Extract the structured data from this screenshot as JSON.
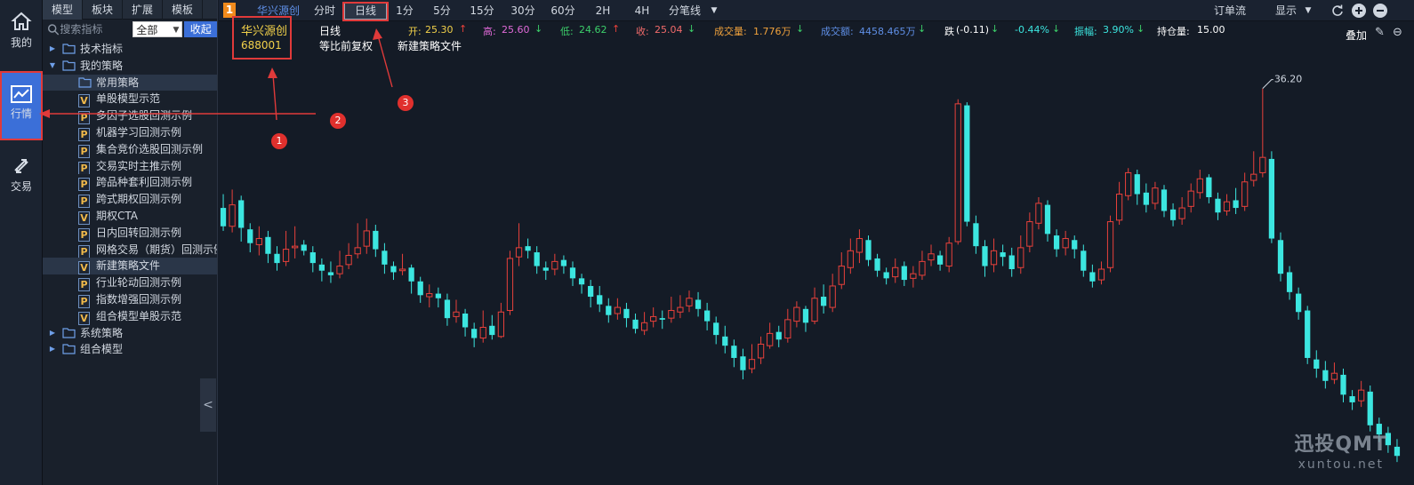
{
  "leftnav": {
    "items": [
      {
        "label": "我的",
        "icon": "home-icon"
      },
      {
        "label": "行情",
        "icon": "chart-icon"
      },
      {
        "label": "交易",
        "icon": "transfer-icon"
      }
    ]
  },
  "panel": {
    "tabs": [
      "模型",
      "板块",
      "扩展",
      "模板"
    ],
    "search_placeholder": "搜索指标",
    "filter_value": "全部",
    "collapse_label": "收起",
    "tree": [
      {
        "label": "技术指标",
        "level": 0,
        "kind": "folder",
        "expanded": false
      },
      {
        "label": "我的策略",
        "level": 0,
        "kind": "folder",
        "expanded": true
      },
      {
        "label": "常用策略",
        "level": 1,
        "kind": "folder",
        "selected": true
      },
      {
        "label": "单股模型示范",
        "level": 1,
        "kind": "V"
      },
      {
        "label": "多因子选股回测示例",
        "level": 1,
        "kind": "P"
      },
      {
        "label": "机器学习回测示例",
        "level": 1,
        "kind": "P"
      },
      {
        "label": "集合竞价选股回测示例",
        "level": 1,
        "kind": "P"
      },
      {
        "label": "交易实时主推示例",
        "level": 1,
        "kind": "P"
      },
      {
        "label": "跨品种套利回测示例",
        "level": 1,
        "kind": "P"
      },
      {
        "label": "跨式期权回测示例",
        "level": 1,
        "kind": "P"
      },
      {
        "label": "期权CTA",
        "level": 1,
        "kind": "V"
      },
      {
        "label": "日内回转回测示例",
        "level": 1,
        "kind": "P"
      },
      {
        "label": "网格交易（期货）回测示例",
        "level": 1,
        "kind": "P"
      },
      {
        "label": "新建策略文件",
        "level": 1,
        "kind": "V",
        "selected": true
      },
      {
        "label": "行业轮动回测示例",
        "level": 1,
        "kind": "P"
      },
      {
        "label": "指数增强回测示例",
        "level": 1,
        "kind": "P"
      },
      {
        "label": "组合模型单股示范",
        "level": 1,
        "kind": "V"
      },
      {
        "label": "系统策略",
        "level": 0,
        "kind": "folder",
        "expanded": false
      },
      {
        "label": "组合模型",
        "level": 0,
        "kind": "folder",
        "expanded": false
      }
    ]
  },
  "toolbar": {
    "tab_number": "1",
    "stock_tab": "华兴源创",
    "periods": [
      "分时",
      "日线",
      "1分",
      "5分",
      "15分",
      "30分",
      "60分",
      "2H",
      "4H",
      "分笔线"
    ],
    "active_period": "日线",
    "order_flow": "订单流",
    "display": "显示"
  },
  "stock": {
    "name": "华兴源创",
    "code": "688001"
  },
  "info": {
    "period": "日线",
    "adjust": "等比前复权",
    "strategy_file": "新建策略文件",
    "open_label": "开:",
    "open": "25.30",
    "high_label": "高:",
    "high": "25.60",
    "low_label": "低:",
    "low": "24.62",
    "close_label": "收:",
    "close": "25.04",
    "volume_label": "成交量:",
    "volume": "1.776万",
    "amount_label": "成交额:",
    "amount": "4458.465万",
    "change_label": "跌",
    "change": "(-0.11)",
    "change_pct": "-0.44%",
    "amplitude_label": "振幅:",
    "amplitude": "3.90%",
    "position_label": "持仓量:",
    "position": "15.00",
    "overlay": "叠加"
  },
  "chart_data": {
    "type": "candlestick",
    "max_label": "36.20",
    "up_color": "#e8413b",
    "down_color": "#3ce6e0",
    "candles": [
      [
        28.4,
        27.2,
        29.3,
        26.9
      ],
      [
        27.2,
        28.6,
        29.6,
        26.8
      ],
      [
        28.9,
        27.1,
        29.2,
        26.2
      ],
      [
        27.0,
        26.1,
        27.4,
        25.5
      ],
      [
        26.0,
        26.4,
        27.2,
        25.3
      ],
      [
        26.5,
        25.4,
        26.9,
        24.8
      ],
      [
        25.4,
        24.8,
        25.9,
        24.3
      ],
      [
        24.9,
        25.7,
        26.9,
        24.6
      ],
      [
        25.8,
        25.9,
        27.2,
        25.1
      ],
      [
        26.0,
        25.6,
        26.3,
        25.3
      ],
      [
        25.5,
        24.8,
        25.9,
        24.2
      ],
      [
        24.7,
        24.3,
        25.1,
        23.6
      ],
      [
        24.2,
        24.0,
        24.9,
        23.5
      ],
      [
        24.1,
        24.6,
        25.6,
        23.8
      ],
      [
        24.7,
        25.3,
        26.1,
        24.4
      ],
      [
        25.4,
        25.8,
        27.4,
        25.1
      ],
      [
        25.9,
        26.9,
        27.7,
        25.4
      ],
      [
        26.9,
        25.7,
        27.3,
        25.2
      ],
      [
        25.6,
        24.7,
        26.1,
        24.1
      ],
      [
        24.6,
        24.2,
        24.9,
        23.7
      ],
      [
        24.3,
        24.4,
        25.4,
        24.0
      ],
      [
        24.5,
        23.6,
        24.7,
        22.8
      ],
      [
        23.6,
        22.7,
        23.9,
        22.2
      ],
      [
        22.6,
        22.8,
        23.4,
        21.9
      ],
      [
        22.8,
        22.5,
        23.2,
        21.9
      ],
      [
        22.4,
        21.2,
        22.8,
        20.7
      ],
      [
        21.3,
        21.6,
        22.4,
        20.9
      ],
      [
        21.5,
        20.6,
        21.8,
        20.0
      ],
      [
        20.5,
        19.9,
        20.9,
        19.3
      ],
      [
        19.9,
        20.6,
        21.7,
        19.6
      ],
      [
        20.7,
        20.1,
        21.4,
        19.8
      ],
      [
        20.0,
        21.6,
        22.2,
        19.9
      ],
      [
        21.7,
        25.1,
        25.6,
        21.4
      ],
      [
        25.2,
        25.8,
        27.4,
        24.6
      ],
      [
        25.9,
        25.6,
        26.4,
        25.1
      ],
      [
        25.5,
        24.6,
        25.9,
        24.1
      ],
      [
        24.5,
        24.3,
        24.9,
        23.7
      ],
      [
        24.4,
        24.9,
        25.4,
        24.0
      ],
      [
        25.0,
        24.6,
        25.3,
        24.1
      ],
      [
        24.5,
        23.8,
        24.9,
        23.3
      ],
      [
        23.8,
        23.4,
        24.1,
        22.8
      ],
      [
        23.3,
        22.6,
        23.7,
        21.9
      ],
      [
        22.7,
        22.1,
        23.3,
        21.6
      ],
      [
        22.0,
        21.4,
        22.5,
        20.9
      ],
      [
        21.5,
        21.9,
        22.5,
        21.1
      ],
      [
        21.8,
        21.2,
        22.2,
        20.6
      ],
      [
        21.1,
        20.5,
        21.5,
        20.2
      ],
      [
        20.4,
        20.9,
        21.6,
        20.1
      ],
      [
        21.0,
        21.3,
        21.9,
        20.6
      ],
      [
        21.2,
        21.1,
        21.7,
        20.5
      ],
      [
        21.2,
        21.7,
        22.6,
        20.9
      ],
      [
        21.6,
        21.9,
        22.7,
        21.2
      ],
      [
        22.0,
        22.5,
        23.0,
        21.6
      ],
      [
        22.4,
        21.8,
        22.9,
        21.3
      ],
      [
        21.7,
        21.0,
        22.2,
        20.4
      ],
      [
        20.9,
        20.1,
        21.3,
        19.5
      ],
      [
        20.0,
        19.4,
        20.7,
        18.9
      ],
      [
        19.4,
        18.6,
        19.8,
        18.0
      ],
      [
        18.7,
        17.8,
        19.2,
        17.2
      ],
      [
        17.9,
        18.5,
        19.5,
        17.6
      ],
      [
        18.6,
        19.5,
        20.0,
        18.2
      ],
      [
        19.4,
        20.2,
        20.9,
        19.2
      ],
      [
        20.3,
        19.8,
        20.7,
        19.3
      ],
      [
        19.9,
        21.1,
        21.8,
        19.6
      ],
      [
        21.0,
        21.9,
        22.3,
        20.6
      ],
      [
        21.8,
        20.9,
        22.0,
        20.3
      ],
      [
        21.0,
        22.5,
        23.2,
        20.8
      ],
      [
        22.6,
        22.0,
        23.4,
        21.5
      ],
      [
        21.9,
        23.3,
        24.1,
        21.6
      ],
      [
        23.4,
        24.6,
        25.5,
        23.1
      ],
      [
        24.5,
        25.6,
        26.4,
        24.1
      ],
      [
        25.5,
        26.4,
        27.0,
        24.8
      ],
      [
        26.3,
        25.0,
        26.6,
        24.6
      ],
      [
        25.1,
        24.3,
        25.4,
        23.9
      ],
      [
        24.2,
        23.8,
        24.5,
        23.4
      ],
      [
        23.9,
        24.5,
        25.1,
        23.5
      ],
      [
        24.6,
        23.7,
        24.9,
        23.3
      ],
      [
        23.8,
        24.1,
        24.6,
        23.2
      ],
      [
        24.0,
        24.9,
        25.6,
        23.7
      ],
      [
        25.0,
        25.4,
        26.0,
        24.6
      ],
      [
        25.3,
        24.7,
        25.6,
        24.3
      ],
      [
        24.6,
        26.1,
        26.5,
        24.2
      ],
      [
        26.2,
        35.2,
        35.5,
        26.0
      ],
      [
        35.1,
        27.5,
        35.3,
        27.2
      ],
      [
        27.4,
        25.9,
        27.9,
        25.4
      ],
      [
        25.9,
        24.6,
        26.3,
        23.9
      ],
      [
        24.7,
        25.6,
        26.4,
        24.2
      ],
      [
        25.5,
        25.2,
        26.0,
        24.6
      ],
      [
        25.3,
        24.4,
        25.8,
        23.9
      ],
      [
        24.5,
        25.8,
        26.6,
        24.1
      ],
      [
        25.9,
        27.5,
        28.1,
        25.5
      ],
      [
        27.4,
        28.7,
        29.1,
        27.0
      ],
      [
        28.6,
        26.7,
        28.9,
        26.2
      ],
      [
        26.6,
        25.7,
        27.0,
        25.2
      ],
      [
        25.8,
        26.4,
        26.9,
        25.3
      ],
      [
        26.3,
        25.7,
        26.6,
        25.1
      ],
      [
        25.6,
        24.3,
        26.0,
        23.9
      ],
      [
        24.2,
        23.6,
        24.7,
        23.2
      ],
      [
        23.7,
        24.4,
        24.9,
        23.4
      ],
      [
        24.5,
        27.5,
        27.9,
        24.2
      ],
      [
        27.6,
        29.3,
        30.1,
        27.3
      ],
      [
        29.2,
        30.7,
        31.0,
        28.9
      ],
      [
        30.6,
        29.3,
        30.9,
        28.6
      ],
      [
        29.4,
        28.6,
        30.0,
        28.1
      ],
      [
        28.7,
        29.7,
        30.1,
        28.3
      ],
      [
        29.6,
        28.2,
        29.9,
        27.8
      ],
      [
        28.3,
        27.6,
        28.7,
        27.2
      ],
      [
        27.7,
        28.4,
        29.1,
        27.3
      ],
      [
        28.5,
        29.5,
        30.0,
        28.1
      ],
      [
        29.4,
        30.3,
        30.9,
        29.0
      ],
      [
        30.4,
        29.1,
        30.6,
        28.7
      ],
      [
        29.0,
        28.1,
        29.4,
        27.6
      ],
      [
        28.2,
        28.8,
        29.3,
        27.9
      ],
      [
        28.9,
        28.4,
        29.7,
        28.0
      ],
      [
        28.5,
        30.1,
        30.7,
        28.2
      ],
      [
        30.2,
        30.6,
        32.1,
        29.8
      ],
      [
        30.7,
        31.7,
        36.2,
        30.4
      ],
      [
        31.6,
        26.4,
        32.1,
        26.1
      ],
      [
        26.3,
        24.1,
        26.8,
        23.6
      ],
      [
        24.2,
        22.9,
        24.6,
        22.4
      ],
      [
        22.8,
        21.6,
        23.2,
        21.1
      ],
      [
        21.7,
        18.6,
        22.0,
        18.2
      ],
      [
        18.5,
        17.9,
        19.1,
        17.3
      ],
      [
        17.8,
        17.1,
        18.4,
        16.6
      ],
      [
        17.2,
        17.6,
        18.3,
        16.9
      ],
      [
        17.5,
        16.2,
        17.9,
        15.7
      ],
      [
        16.1,
        15.7,
        16.5,
        15.2
      ],
      [
        15.8,
        16.5,
        17.1,
        15.4
      ],
      [
        16.4,
        14.2,
        16.8,
        13.8
      ],
      [
        14.3,
        13.6,
        14.7,
        13.1
      ],
      [
        13.7,
        12.9,
        14.1,
        12.4
      ],
      [
        12.8,
        12.2,
        13.3,
        11.8
      ]
    ]
  },
  "watermark": {
    "brand": "迅投QMT",
    "site": "xuntou.net"
  },
  "annotations": [
    "1",
    "2",
    "3"
  ],
  "annotation_color": "#e03a3a"
}
